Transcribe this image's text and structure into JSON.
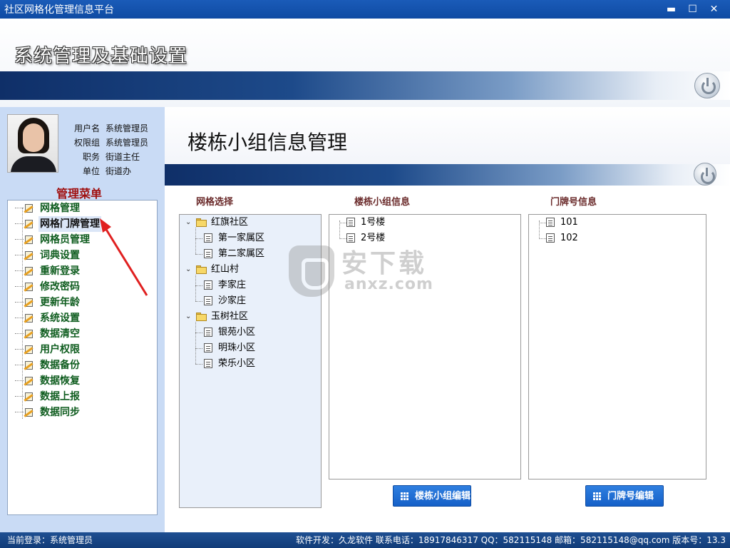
{
  "window": {
    "title": "社区网格化管理信息平台",
    "min_glyph": "▬",
    "max_glyph": "☐",
    "close_glyph": "✕"
  },
  "header": {
    "subtitle": "系统管理及基础设置"
  },
  "user": {
    "rows": [
      {
        "label": "用户名",
        "value": "系统管理员"
      },
      {
        "label": "权限组",
        "value": "系统管理员"
      },
      {
        "label": "职务",
        "value": "街道主任"
      },
      {
        "label": "单位",
        "value": "街道办"
      }
    ]
  },
  "menu": {
    "title": "管理菜单",
    "selected_index": 1,
    "items": [
      "网格管理",
      "网格门牌管理",
      "网格员管理",
      "词典设置",
      "重新登录",
      "修改密码",
      "更新年龄",
      "系统设置",
      "数据清空",
      "用户权限",
      "数据备份",
      "数据恢复",
      "数据上报",
      "数据同步"
    ]
  },
  "page": {
    "title": "楼栋小组信息管理"
  },
  "sections": {
    "grid_select": "网格选择",
    "building_info": "楼栋小组信息",
    "door_info": "门牌号信息"
  },
  "tree": [
    {
      "name": "红旗社区",
      "children": [
        "第一家属区",
        "第二家属区"
      ]
    },
    {
      "name": "红山村",
      "children": [
        "李家庄",
        "沙家庄"
      ]
    },
    {
      "name": "玉树社区",
      "children": [
        "银苑小区",
        "明珠小区",
        "荣乐小区"
      ]
    }
  ],
  "buildings": [
    "1号楼",
    "2号楼"
  ],
  "doors": [
    "101",
    "102"
  ],
  "buttons": {
    "edit_building": "楼栋小组编辑",
    "edit_door": "门牌号编辑"
  },
  "watermark": {
    "cn": "安下载",
    "en": "anxz.com"
  },
  "status": {
    "current_login": "当前登录：系统管理员",
    "right": "软件开发：久龙软件   联系电话：18917846317   QQ：582115148 邮箱：582115148@qq.com   版本号：13.3"
  },
  "colors": {
    "menu_text": "#0e5c1e",
    "menu_title": "#a01010",
    "section_label": "#6a2a2a",
    "button": "#1560c8",
    "titlebar": "#1a5bb8"
  }
}
